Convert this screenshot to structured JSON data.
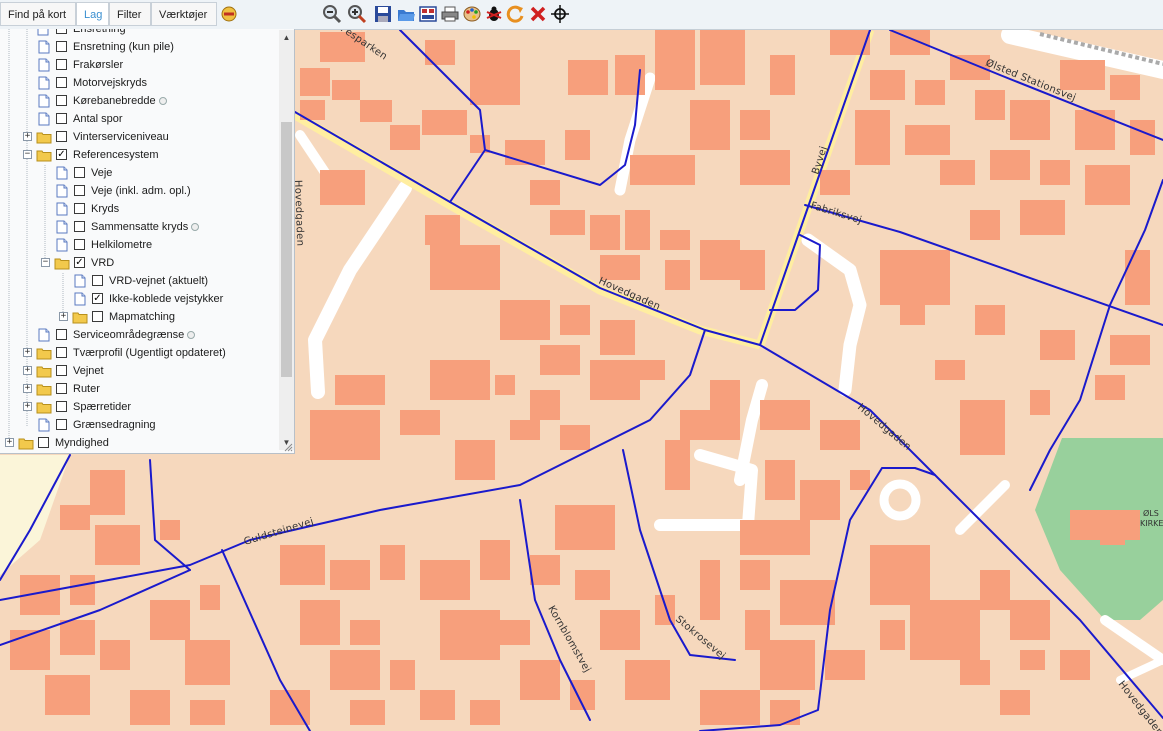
{
  "toolbar": {
    "tabs": [
      "Find på kort",
      "Lag",
      "Filter",
      "Værktøjer"
    ],
    "active_tab": "Lag",
    "tools": [
      "zoom-out-icon",
      "zoom-in-icon",
      "save-icon",
      "open-folder-icon",
      "print-layout-icon",
      "print-icon",
      "palette-icon",
      "bug-icon",
      "refresh-icon",
      "close-icon",
      "crosshair-icon"
    ]
  },
  "layers": {
    "top_partial": "Ensretning",
    "items": [
      {
        "label": "Ensretning (kun pile)",
        "checked": false,
        "folder": false
      },
      {
        "label": "Frakørsler",
        "checked": false,
        "folder": false
      },
      {
        "label": "Motorvejskryds",
        "checked": false,
        "folder": false
      },
      {
        "label": "Kørebanebredde",
        "checked": false,
        "folder": false,
        "info": true
      },
      {
        "label": "Antal spor",
        "checked": false,
        "folder": false
      },
      {
        "label": "Vinterserviceniveau",
        "checked": false,
        "folder": true,
        "expanded": false
      },
      {
        "label": "Referencesystem",
        "checked": true,
        "folder": true,
        "expanded": true
      },
      {
        "label": "Veje",
        "checked": false,
        "folder": false
      },
      {
        "label": "Veje (inkl. adm. opl.)",
        "checked": false,
        "folder": false
      },
      {
        "label": "Kryds",
        "checked": false,
        "folder": false
      },
      {
        "label": "Sammensatte kryds",
        "checked": false,
        "folder": false,
        "info": true
      },
      {
        "label": "Helkilometre",
        "checked": false,
        "folder": false
      },
      {
        "label": "VRD",
        "checked": true,
        "folder": true,
        "expanded": true
      },
      {
        "label": "VRD-vejnet (aktuelt)",
        "checked": false,
        "folder": false
      },
      {
        "label": "Ikke-koblede vejstykker",
        "checked": true,
        "folder": false
      },
      {
        "label": "Mapmatching",
        "checked": false,
        "folder": true,
        "expanded": false
      },
      {
        "label": "Serviceområdegrænse",
        "checked": false,
        "folder": false,
        "info": true
      },
      {
        "label": "Tværprofil (Ugentligt opdateret)",
        "checked": false,
        "folder": true,
        "expanded": false
      },
      {
        "label": "Vejnet",
        "checked": false,
        "folder": true,
        "expanded": false
      },
      {
        "label": "Ruter",
        "checked": false,
        "folder": true,
        "expanded": false
      },
      {
        "label": "Spærretider",
        "checked": false,
        "folder": true,
        "expanded": false
      },
      {
        "label": "Grænsedragning",
        "checked": false,
        "folder": false
      },
      {
        "label": "Myndighed",
        "checked": false,
        "folder": true,
        "expanded": false
      }
    ]
  },
  "map": {
    "colors": {
      "land": "#f6d8bd",
      "building": "#f79f7c",
      "road": "#ffffff",
      "line": "#1a1acc",
      "main_road": "#ffeea0",
      "park": "#98d09c",
      "sand": "#fbf5d9"
    },
    "street_labels": [
      "Hovedgaden",
      "Hovedgaden",
      "Byvej",
      "Fabriksvej",
      "Ølsted Stationsvej",
      "Guldsteinevej",
      "Kornblomstvej",
      "Stokrosevej",
      "Hovedgaden",
      "Fesparken",
      "Hovedgaden"
    ],
    "poi": [
      "ØLS",
      "KIRKE"
    ]
  }
}
